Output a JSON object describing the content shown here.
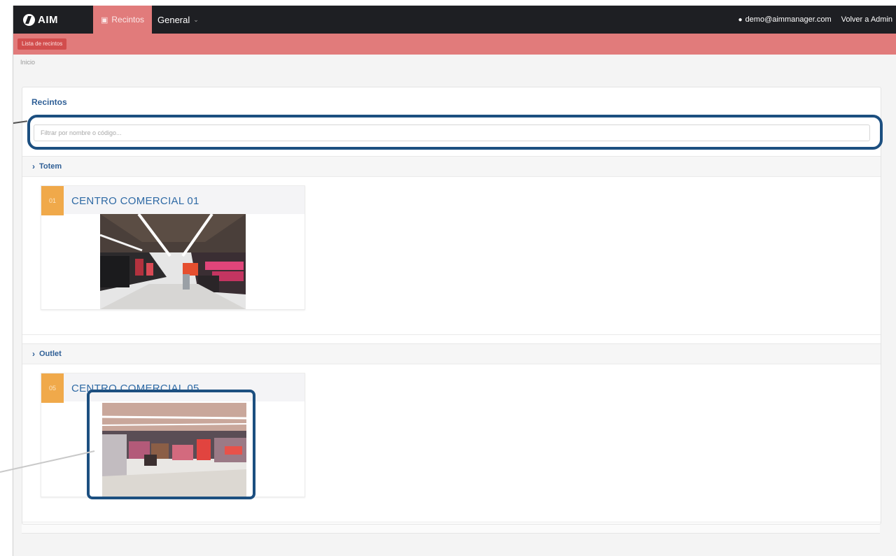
{
  "navbar": {
    "brand": "AIM",
    "nav_recintos": "Recintos",
    "nav_general": "General",
    "user_email": "demo@aimmanager.com",
    "back_admin": "Volver a Admin"
  },
  "subbar": {
    "button_label": "Lista de recintos"
  },
  "breadcrumb": "Inicio",
  "panel": {
    "title": "Recintos",
    "filter_placeholder": "Filtrar por nombre o código..."
  },
  "groups": [
    {
      "name": "Totem",
      "cards": [
        {
          "badge": "01",
          "title": "CENTRO COMERCIAL 01"
        }
      ]
    },
    {
      "name": "Outlet",
      "cards": [
        {
          "badge": "05",
          "title": "CENTRO COMERCIAL 05"
        }
      ]
    }
  ],
  "colors": {
    "navbar": "#1e1f23",
    "accent_red": "#e17b7b",
    "title_blue": "#2f5f96",
    "badge_orange": "#f0a94a",
    "callout_blue": "#1c4f80"
  }
}
